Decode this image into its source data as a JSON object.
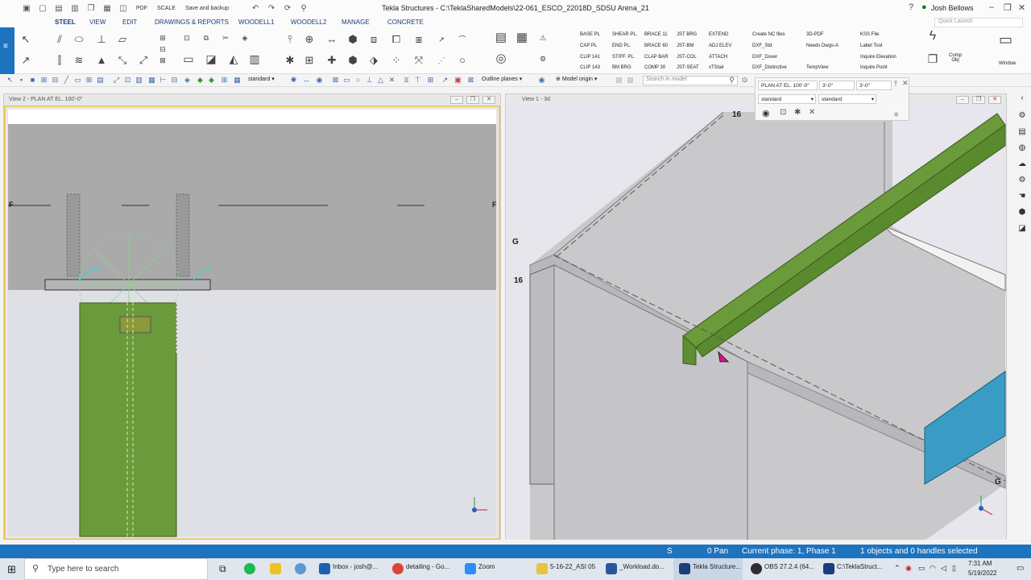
{
  "titlebar": {
    "title": "Tekla Structures - C:\\TeklaSharedModels\\22-061_ESCO_22018D_SDSU Arena_21",
    "user": "Josh Bellows",
    "quick_launch_placeholder": "Quick Launch",
    "qa_pdf": "PDF",
    "qa_scale": "SCALE",
    "qa_save": "Save and backup"
  },
  "menu": {
    "tabs": [
      "STEEL",
      "VIEW",
      "EDIT",
      "DRAWINGS & REPORTS",
      "WOODELL1",
      "WOODELL2",
      "MANAGE",
      "CONCRETE"
    ]
  },
  "ribbon": {
    "macros_col1": [
      "BASE PL",
      "CAP PL",
      "CLIP 141",
      "CLIP 143"
    ],
    "macros_col2": [
      "SHEAR PL.",
      "END PL.",
      "STIFF. PL.",
      "BM BRG"
    ],
    "macros_col3": [
      "BRACE 11",
      "BRACE 60",
      "CLAP BAR",
      "COMP 30"
    ],
    "macros_col4": [
      "JST BRG",
      "JST-BM",
      "JST-COL",
      "JST-SEAT"
    ],
    "macros_col5": [
      "EXTEND",
      "ADJ ELEV",
      "ATTACH",
      "xTStair"
    ],
    "macros_col6": [
      "Create NC files",
      "DXF_Std",
      "DXF_Dover",
      "DXF_Distinctive"
    ],
    "macros_col7": [
      "3D-PDF",
      "Needs Dwgs-A",
      "",
      "TempView"
    ],
    "macros_col8": [
      "KSS File",
      "Label Tool",
      "Inquire Elevation",
      "Inquire Point"
    ],
    "comp_obj": "Comp Obj",
    "window": "Window"
  },
  "toolbar": {
    "select_standard": "standard",
    "outline_planes": "Outline planes",
    "model_origin": "Model origin",
    "search_placeholder": "Search in model"
  },
  "view_dialog": {
    "view_name": "PLAN AT EL. 100'-0\"",
    "depth_up": "3'-0\"",
    "depth_down": "3'-0\"",
    "prop1": "standard",
    "prop2": "standard"
  },
  "view2": {
    "title": "View 2 - PLAN AT EL. 100'-0\"",
    "grid_label_left": "F",
    "grid_label_right": "F"
  },
  "view1": {
    "title": "View 1 - 3d",
    "grid_label_16_top": "16",
    "grid_label_g_left": "G",
    "grid_label_16_left": "16",
    "grid_label_g_right": "G"
  },
  "status": {
    "snap": "S",
    "pan": "0 Pan",
    "phase": "Current phase: 1, Phase 1",
    "selection": "1 objects and 0 handles selected"
  },
  "taskbar": {
    "search_placeholder": "Type here to search",
    "apps": [
      "Inbox - josh@...",
      "detailing - Go...",
      "Zoom",
      "5-16-22_ASI 05",
      "_Workload.do...",
      "Tekla Structure...",
      "OBS 27.2.4 (64...",
      "C:\\TeklaStruct..."
    ],
    "time": "7:31 AM",
    "date": "5/19/2022"
  },
  "colors": {
    "accent": "#1e73be",
    "steel_green": "#6a9a3a",
    "beam_blue": "#3a9cc4",
    "view_border_active": "#e8c442"
  }
}
